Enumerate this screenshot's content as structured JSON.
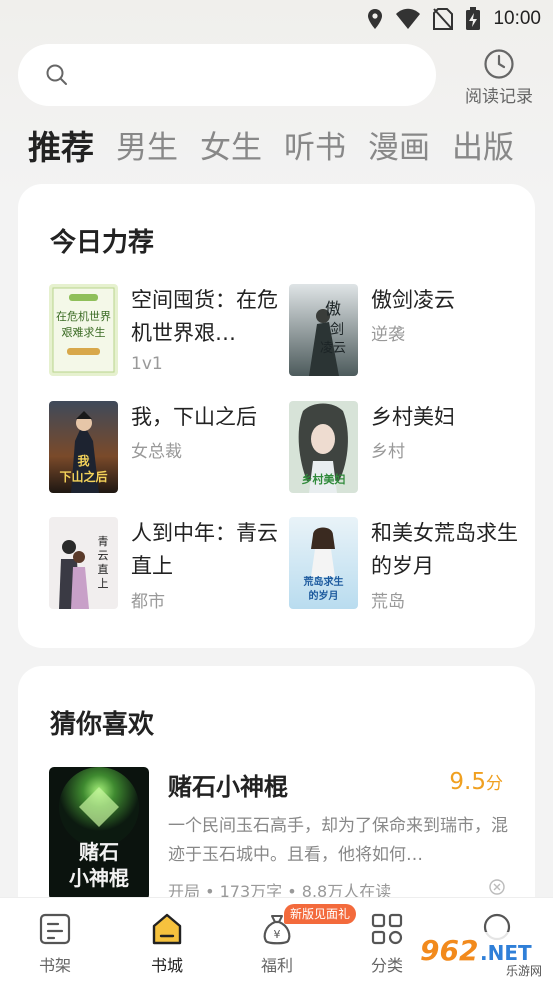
{
  "status_bar": {
    "time": "10:00",
    "icons": [
      "location-icon",
      "wifi-icon",
      "no-sim-icon",
      "battery-charging-icon"
    ]
  },
  "search": {
    "placeholder": "",
    "icon": "search-icon"
  },
  "history": {
    "label": "阅读记录",
    "icon": "clock-icon"
  },
  "tabs": [
    {
      "label": "推荐",
      "active": true
    },
    {
      "label": "男生",
      "active": false
    },
    {
      "label": "女生",
      "active": false
    },
    {
      "label": "听书",
      "active": false
    },
    {
      "label": "漫画",
      "active": false
    },
    {
      "label": "出版",
      "active": false
    }
  ],
  "recommend": {
    "title": "今日力荐",
    "books": [
      {
        "title": "空间囤货：在危机世界艰…",
        "tag": "1v1",
        "cover_text": "在危机世界艰难求生"
      },
      {
        "title": "傲剑凌云",
        "tag": "逆袭",
        "cover_text": "傲剑凌云"
      },
      {
        "title": "我，下山之后",
        "tag": "女总裁",
        "cover_text": "我下山之后"
      },
      {
        "title": "乡村美妇",
        "tag": "乡村",
        "cover_text": "乡村美妇"
      },
      {
        "title": "人到中年：青云直上",
        "tag": "都市",
        "cover_text": "青云直上"
      },
      {
        "title": "和美女荒岛求生的岁月",
        "tag": "荒岛",
        "cover_text": "荒岛求生的岁月"
      }
    ]
  },
  "guess": {
    "title": "猜你喜欢",
    "book": {
      "title": "赌石小神棍",
      "score": "9.5",
      "score_unit": "分",
      "description": "一个民间玉石高手，却为了保命来到瑞市，混迹于玉石城中。且看，他将如何…",
      "meta": "开局 • 173万字 • 8.8万人在读",
      "cover_text": "赌石小神棍"
    }
  },
  "bottom_nav": {
    "items": [
      {
        "label": "书架",
        "icon": "bookshelf-icon",
        "active": false
      },
      {
        "label": "书城",
        "icon": "home-icon",
        "active": true
      },
      {
        "label": "福利",
        "icon": "money-bag-icon",
        "active": false
      },
      {
        "label": "分类",
        "icon": "category-grid-icon",
        "active": false
      },
      {
        "label": "",
        "icon": "profile-icon",
        "active": false
      }
    ],
    "gift_badge": "新版见面礼"
  },
  "watermark": {
    "brand": "962",
    "domain": ".NET",
    "subtitle": "乐游网"
  },
  "colors": {
    "accent_orange": "#f0a020",
    "badge_red": "#f36a3c",
    "card_bg": "#ffffff",
    "page_bg": "#f3f3f3"
  }
}
